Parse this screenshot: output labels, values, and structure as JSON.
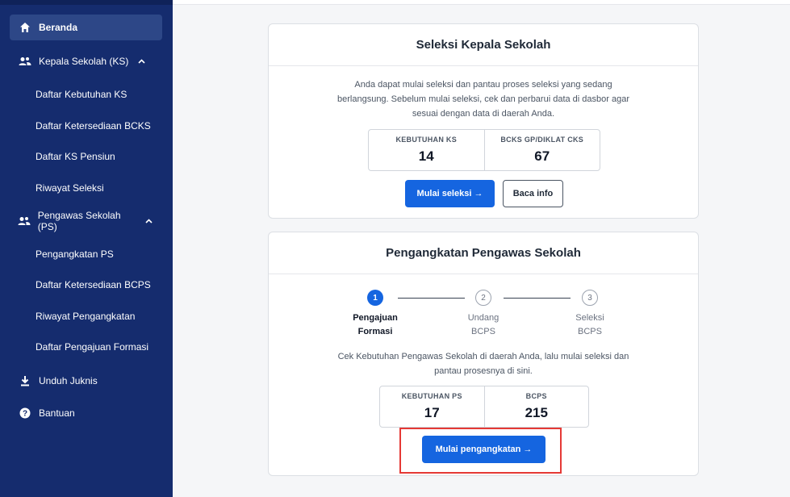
{
  "sidebar": {
    "home": "Beranda",
    "ks_group": "Kepala Sekolah (KS)",
    "ks_items": [
      "Daftar Kebutuhan KS",
      "Daftar Ketersediaan BCKS",
      "Daftar KS Pensiun",
      "Riwayat Seleksi"
    ],
    "ps_group": "Pengawas Sekolah (PS)",
    "ps_items": [
      "Pengangkatan PS",
      "Daftar Ketersediaan BCPS",
      "Riwayat Pengangkatan",
      "Daftar Pengajuan Formasi"
    ],
    "download": "Unduh Juknis",
    "help": "Bantuan",
    "icons": [
      "home-icon",
      "users-icon",
      "chevron-up-icon",
      "download-icon",
      "help-icon"
    ]
  },
  "seleksi": {
    "title": "Seleksi Kepala Sekolah",
    "desc_line1": "Anda dapat mulai seleksi dan pantau proses seleksi yang sedang",
    "desc_line2": "berlangsung. Sebelum mulai seleksi, cek dan perbarui data di dasbor agar",
    "desc_line3": "sesuai dengan data di daerah Anda.",
    "stat1_label": "KEBUTUHAN KS",
    "stat1_value": "14",
    "stat2_label": "BCKS GP/DIKLAT CKS",
    "stat2_value": "67",
    "primary_btn": "Mulai seleksi →",
    "secondary_btn": "Baca info"
  },
  "pengangkatan": {
    "title": "Pengangkatan Pengawas Sekolah",
    "steps": [
      {
        "num": "1",
        "line1": "Pengajuan",
        "line2": "Formasi"
      },
      {
        "num": "2",
        "line1": "Undang",
        "line2": "BCPS"
      },
      {
        "num": "3",
        "line1": "Seleksi",
        "line2": "BCPS"
      }
    ],
    "desc_line1": "Cek Kebutuhan Pengawas Sekolah di daerah Anda, lalu mulai seleksi dan",
    "desc_line2": "pantau prosesnya di sini.",
    "stat1_label": "KEBUTUHAN PS",
    "stat1_value": "17",
    "stat2_label": "BCPS",
    "stat2_value": "215",
    "primary_btn": "Mulai pengangkatan →"
  },
  "colors": {
    "sidebar_bg": "#152c6e",
    "accent": "#1565e0",
    "highlight": "#e53935"
  }
}
